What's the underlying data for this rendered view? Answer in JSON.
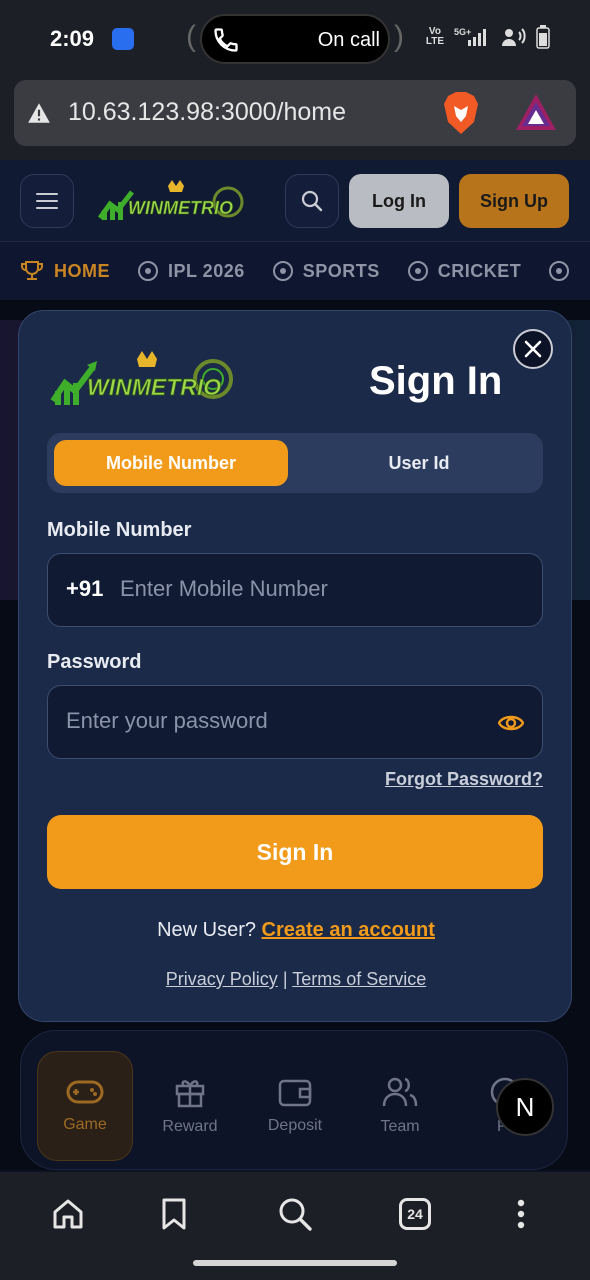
{
  "status_bar": {
    "time": "2:09",
    "call_text": "On call",
    "volte_top": "Vo",
    "volte_bottom": "LTE",
    "network": "5G+"
  },
  "browser": {
    "url": "10.63.123.98:3000/home"
  },
  "header": {
    "login_label": "Log In",
    "signup_label": "Sign Up"
  },
  "nav": {
    "items": [
      {
        "label": "HOME"
      },
      {
        "label": "IPL 2026"
      },
      {
        "label": "SPORTS"
      },
      {
        "label": "CRICKET"
      }
    ]
  },
  "modal": {
    "title": "Sign In",
    "tabs": [
      {
        "label": "Mobile Number"
      },
      {
        "label": "User Id"
      }
    ],
    "mobile_label": "Mobile Number",
    "mobile_prefix": "+91",
    "mobile_placeholder": "Enter Mobile Number",
    "password_label": "Password",
    "password_placeholder": "Enter your password",
    "forgot_label": "Forgot Password?",
    "submit_label": "Sign In",
    "new_user_text": "New User?",
    "create_account_label": "Create an account",
    "privacy_label": "Privacy Policy",
    "separator": "|",
    "terms_label": "Terms of Service"
  },
  "bottom_nav": {
    "items": [
      {
        "label": "Game"
      },
      {
        "label": "Reward"
      },
      {
        "label": "Deposit"
      },
      {
        "label": "Team"
      },
      {
        "label": "Pr"
      }
    ]
  },
  "fab_label": "N",
  "android_nav": {
    "tab_count": "24"
  },
  "colors": {
    "accent": "#f29a1a",
    "modal_bg": "#1b2a48",
    "page_bg": "#0d1222"
  }
}
